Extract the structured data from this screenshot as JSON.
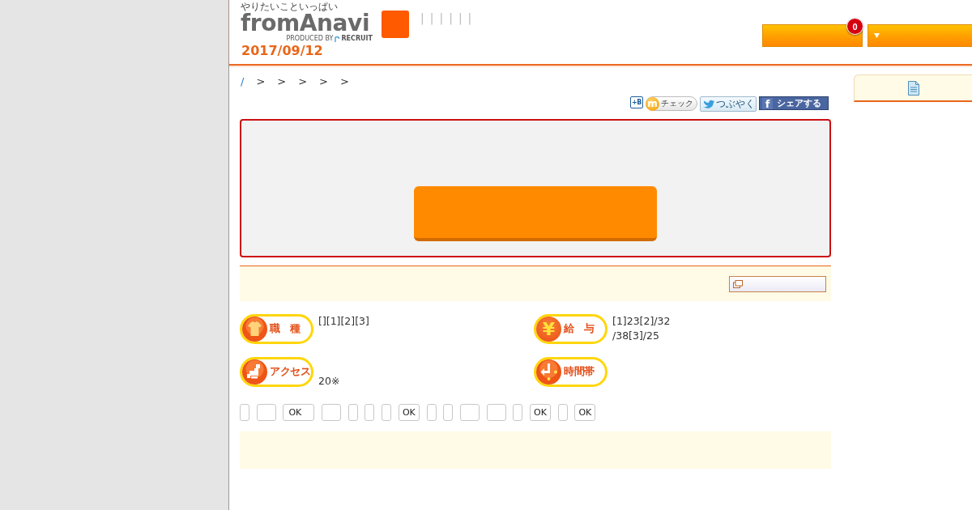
{
  "header": {
    "tagline": "やりたいこといっぱい",
    "logo": "fromAnavi",
    "producer": "PRODUCED BY",
    "brand": "RECRUIT",
    "date": "2017/09/12",
    "separators": [
      "|",
      "|",
      "|",
      "|",
      "|",
      "|"
    ],
    "buttons": [
      {
        "kind": "badge",
        "badge": "0"
      },
      {
        "kind": "dropdown"
      }
    ]
  },
  "breadcrumb": [
    {
      "kind": "link",
      "text": "/"
    },
    {
      "kind": "separator",
      "text": ">"
    },
    {
      "kind": "separator",
      "text": ">"
    },
    {
      "kind": "separator",
      "text": ">"
    },
    {
      "kind": "separator",
      "text": ">"
    },
    {
      "kind": "separator",
      "text": ">"
    }
  ],
  "share_buttons": [
    {
      "kind": "hatena",
      "label": "+B"
    },
    {
      "kind": "mixi",
      "icon_text": "m",
      "label": "チェック"
    },
    {
      "kind": "twitter",
      "label": "つぶやく"
    },
    {
      "kind": "facebook",
      "icon_text": "f",
      "label": "シェアする"
    }
  ],
  "feature_box": {
    "button": {
      "kind": "large"
    }
  },
  "detail_bar": {
    "button": {
      "kind": "popup"
    }
  },
  "info_items": [
    {
      "kind": "job",
      "label": "職　種",
      "lines": [
        "[][1][2][3]"
      ]
    },
    {
      "kind": "salary",
      "icon_text": "¥",
      "label": "給　与",
      "lines": [
        "[1]23[2]/32",
        "/38[3]/25"
      ]
    },
    {
      "kind": "access",
      "label": "アクセス",
      "lines": [
        "20※"
      ]
    },
    {
      "kind": "time",
      "label": "時間帯"
    }
  ],
  "controls": [
    {
      "kind": "narrow"
    },
    {
      "kind": "wide"
    },
    {
      "kind": "input",
      "value": "OK"
    },
    {
      "kind": "wide"
    },
    {
      "kind": "narrow"
    },
    {
      "kind": "narrow"
    },
    {
      "kind": "narrow"
    },
    {
      "kind": "button",
      "label": "OK"
    },
    {
      "kind": "narrow"
    },
    {
      "kind": "narrow"
    },
    {
      "kind": "wide"
    },
    {
      "kind": "wide"
    },
    {
      "kind": "narrow"
    },
    {
      "kind": "button",
      "label": "OK"
    },
    {
      "kind": "narrow"
    },
    {
      "kind": "button",
      "label": "OK"
    }
  ],
  "notice_panel": {
    "kind": "plain"
  },
  "sidebar_tabs": [
    {
      "kind": "document"
    }
  ]
}
